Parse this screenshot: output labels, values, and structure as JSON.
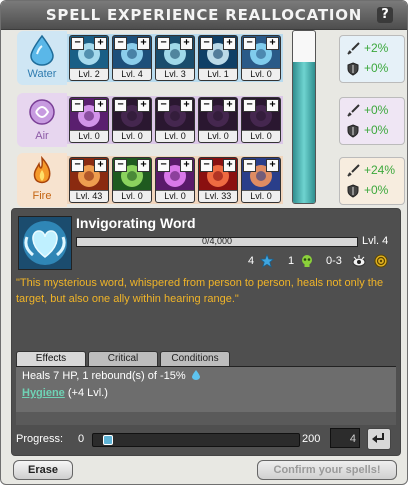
{
  "title": "Spell Experience Reallocation",
  "help_label": "?",
  "colors": {
    "water": "#3a9ad0",
    "air": "#b07ac8",
    "fire": "#e07a24",
    "positive": "#3ca83c",
    "xp_gauge": "#3fa3a0",
    "description": "#f0b428"
  },
  "gauge": {
    "fill_fraction": 0.82
  },
  "elements": [
    {
      "name": "Water",
      "icon": "water-drop-icon",
      "spells": [
        {
          "level_text": "Lvl. 2",
          "icon": "heart-wing-icon"
        },
        {
          "level_text": "Lvl. 4",
          "icon": "twin-heart-icon"
        },
        {
          "level_text": "Lvl. 3",
          "icon": "heart-glow-icon"
        },
        {
          "level_text": "Lvl. 1",
          "icon": "ice-burst-icon"
        },
        {
          "level_text": "Lvl. 0",
          "icon": "potion-icon"
        }
      ],
      "stats": {
        "damage": "+2%",
        "resistance": "+0%"
      }
    },
    {
      "name": "Air",
      "icon": "air-swirl-icon",
      "spells": [
        {
          "level_text": "Lvl. 0",
          "icon": "wind-orb-icon"
        },
        {
          "level_text": "Lvl. 0",
          "icon": "shadow-figure-icon"
        },
        {
          "level_text": "Lvl. 0",
          "icon": "shadow-hand-icon"
        },
        {
          "level_text": "Lvl. 0",
          "icon": "shadow-bat-icon"
        },
        {
          "level_text": "Lvl. 0",
          "icon": "shadow-orb-icon"
        }
      ],
      "stats": {
        "damage": "+0%",
        "resistance": "+0%"
      }
    },
    {
      "name": "Fire",
      "icon": "flame-icon",
      "spells": [
        {
          "level_text": "Lvl. 43",
          "icon": "fire-orb-icon"
        },
        {
          "level_text": "Lvl. 0",
          "icon": "green-swirl-icon"
        },
        {
          "level_text": "Lvl. 0",
          "icon": "purple-flame-icon"
        },
        {
          "level_text": "Lvl. 33",
          "icon": "fire-wings-icon"
        },
        {
          "level_text": "Lvl. 0",
          "icon": "fire-water-icon"
        }
      ],
      "stats": {
        "damage": "+24%",
        "resistance": "+0%"
      }
    }
  ],
  "spell_detail": {
    "name": "Invigorating Word",
    "xp_text": "0/4,000",
    "level": "Lvl. 4",
    "ap_cost": "4",
    "critical": "1",
    "range": "0-3",
    "description": "\"This mysterious word, whispered from person to person, heals not only the target, but also one ally within hearing range.\"",
    "tabs": [
      "Effects",
      "Critical",
      "Conditions"
    ],
    "effects": {
      "line1": "Heals 7 HP, 1 rebound(s) of -15%",
      "hygiene_name": "Hygiene",
      "hygiene_suffix": " (+4 Lvl.)"
    }
  },
  "progress": {
    "label": "Progress:",
    "min": "0",
    "max": "200",
    "value": "4",
    "fraction": 0.02
  },
  "buttons": {
    "erase": "Erase",
    "confirm": "Confirm your spells!"
  }
}
